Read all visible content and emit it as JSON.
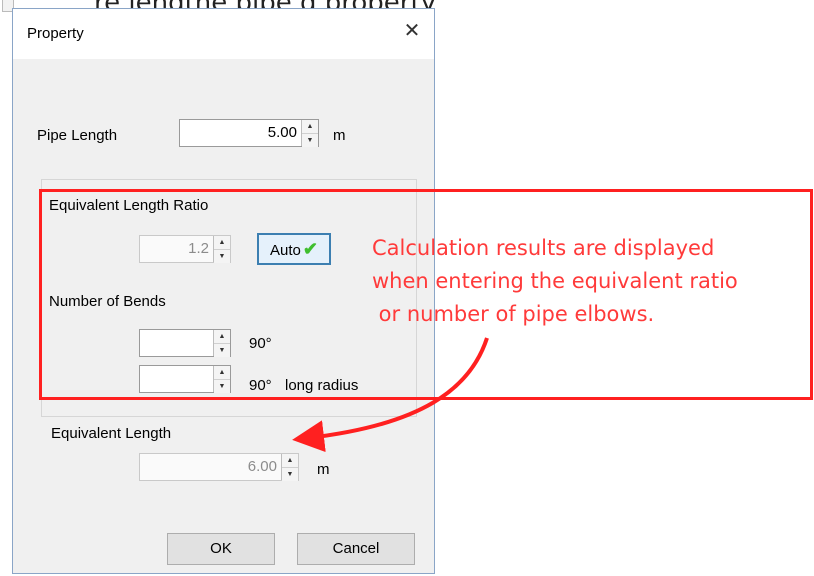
{
  "caption_partial": "re lengthe      pipe       g property",
  "dialog": {
    "title": "Property",
    "close_glyph": "✕",
    "pipe_length": {
      "label": "Pipe Length",
      "value": "5.00",
      "unit": "m"
    },
    "equivalent_length_ratio": {
      "label": "Equivalent Length Ratio",
      "value": "1.2",
      "auto_label": "Auto",
      "auto_check": "✔"
    },
    "number_of_bends": {
      "label": "Number of Bends",
      "rows": [
        {
          "value": "",
          "unit": "90°",
          "note": ""
        },
        {
          "value": "",
          "unit": "90°",
          "note": "long radius"
        }
      ]
    },
    "equivalent_length": {
      "label": "Equivalent Length",
      "value": "6.00",
      "unit": "m"
    },
    "ok_label": "OK",
    "cancel_label": "Cancel"
  },
  "annotation": {
    "text": "Calculation results are displayed\nwhen entering the equivalent ratio\n or number of pipe elbows.",
    "color": "#ff3a3a"
  },
  "colors": {
    "highlight": "#ff2020",
    "check": "#3fbf2f",
    "auto_border": "#3c7fb1"
  }
}
